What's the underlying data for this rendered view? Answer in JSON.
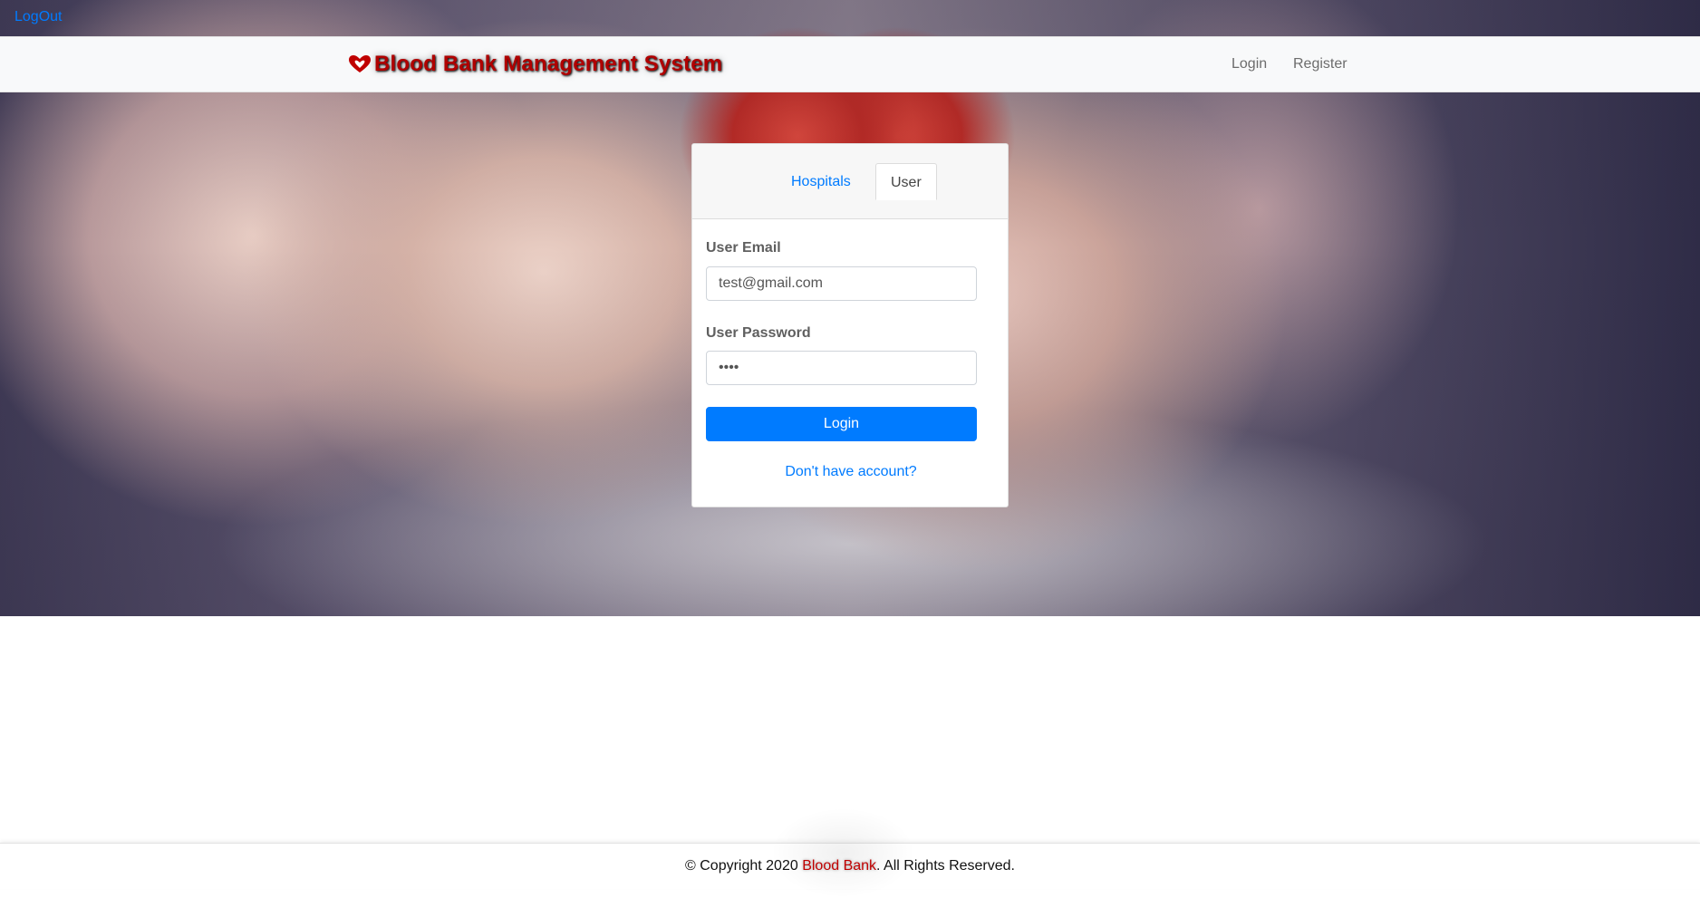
{
  "top_link": {
    "logout_label": "LogOut"
  },
  "navbar": {
    "brand_icon": "heart-hands-icon",
    "brand_title": "Blood Bank Management System",
    "links": [
      {
        "label": "Login"
      },
      {
        "label": "Register"
      }
    ]
  },
  "login_card": {
    "tabs": [
      {
        "label": "Hospitals",
        "active": false
      },
      {
        "label": "User",
        "active": true
      }
    ],
    "email": {
      "label": "User Email",
      "value": "test@gmail.com"
    },
    "password": {
      "label": "User Password",
      "value": "test"
    },
    "submit_label": "Login",
    "signup_link": "Don't have account?"
  },
  "footer": {
    "prefix": "© Copyright 2020 ",
    "brand": "Blood Bank",
    "suffix": ". All Rights Reserved."
  },
  "colors": {
    "accent": "#007bff",
    "brand_red": "#b00000",
    "navbar_bg": "#f8f9fa"
  }
}
